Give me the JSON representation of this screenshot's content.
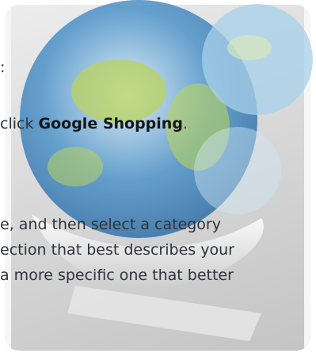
{
  "doc": {
    "line1": ":",
    "line2_prefix": " click ",
    "line2_bold": "Google Shopping",
    "line2_suffix": ".",
    "line3": "e, and then select a category",
    "line4": "ection that best describes your",
    "line5": "a more specific one that better"
  },
  "colors": {
    "text": "#2f3336",
    "bold_text": "#151618",
    "frame_gray": "#d9d9d9",
    "globe_blue": "#4f94c9",
    "globe_green": "#b9d35d"
  },
  "icon": "magnifier-over-globe-icon"
}
